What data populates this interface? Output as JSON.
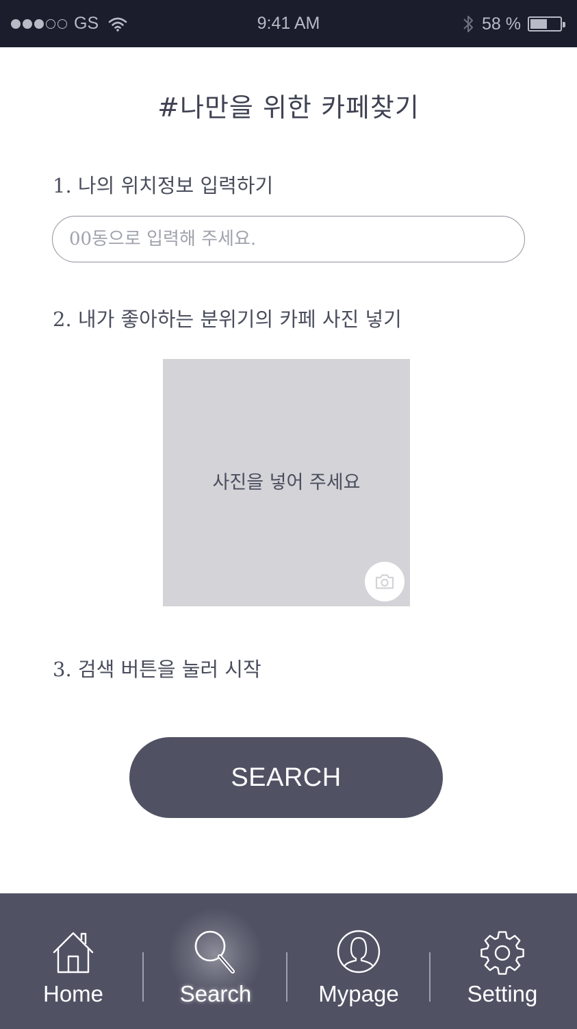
{
  "status_bar": {
    "carrier": "GS",
    "time": "9:41 AM",
    "battery_percent": "58 %",
    "battery_level": 0.58
  },
  "page": {
    "title": "#나만을 위한 카페찾기"
  },
  "steps": {
    "step1_label": "1. 나의 위치정보 입력하기",
    "location_placeholder": "00동으로 입력해 주세요.",
    "location_value": "",
    "step2_label": "2. 내가 좋아하는 분위기의 카페 사진 넣기",
    "photo_prompt": "사진을 넣어 주세요",
    "step3_label": "3. 검색 버튼을 눌러 시작"
  },
  "search_button": {
    "label": "SEARCH"
  },
  "tab_bar": {
    "active": "Search",
    "tabs": [
      {
        "label": "Home",
        "icon": "home-icon"
      },
      {
        "label": "Search",
        "icon": "search-icon"
      },
      {
        "label": "Mypage",
        "icon": "user-icon"
      },
      {
        "label": "Setting",
        "icon": "gear-icon"
      }
    ]
  },
  "colors": {
    "status_bar_bg": "#1c1d2c",
    "accent": "#505264",
    "photo_placeholder_bg": "#d3d3d8",
    "text": "#4a4d5c"
  }
}
